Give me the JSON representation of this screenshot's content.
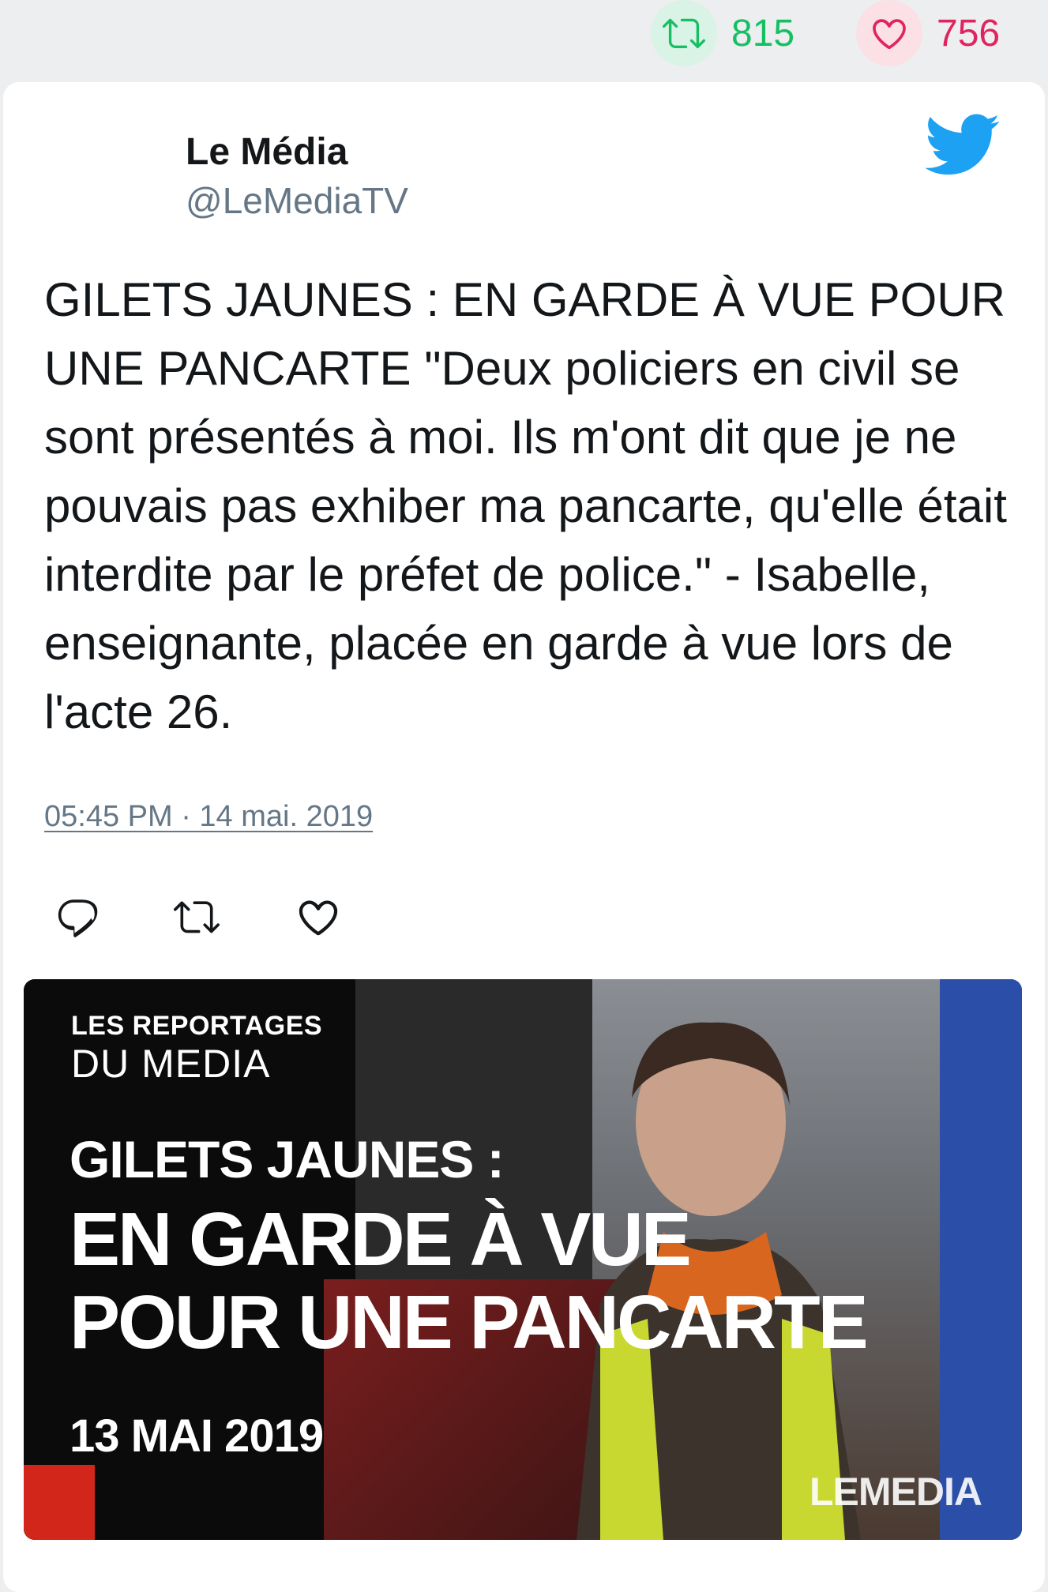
{
  "stats": {
    "retweet_count": "815",
    "like_count": "756"
  },
  "tweet": {
    "author_name": "Le Média",
    "author_handle": "@LeMediaTV",
    "text": "GILETS JAUNES : EN GARDE À VUE POUR UNE PANCARTE \"Deux policiers en civil se sont présentés à moi. Ils m'ont dit que je ne pouvais pas exhiber ma pancarte, qu'elle était interdite par le préfet de police.\" - Isabelle, enseignante, placée en garde à vue lors de l'acte 26.",
    "timestamp": "05:45 PM · 14 mai. 2019"
  },
  "media": {
    "line1": "LES REPORTAGES",
    "line2": "DU MEDIA",
    "headline_top": "GILETS JAUNES :",
    "headline_1": "EN GARDE À VUE",
    "headline_2": "POUR UNE PANCARTE",
    "date": "13 MAI 2019",
    "brand": "LEMEDIA"
  },
  "icons": {
    "stat_retweet": "retweet-icon",
    "stat_like": "heart-icon",
    "brand": "twitter-bird-icon",
    "reply": "reply-icon",
    "retweet": "retweet-icon",
    "like": "heart-icon"
  },
  "colors": {
    "retweet_green": "#17bf63",
    "like_pink": "#e0245e",
    "twitter_blue": "#1da1f2",
    "muted_gray": "#657786",
    "text": "#14171a"
  }
}
